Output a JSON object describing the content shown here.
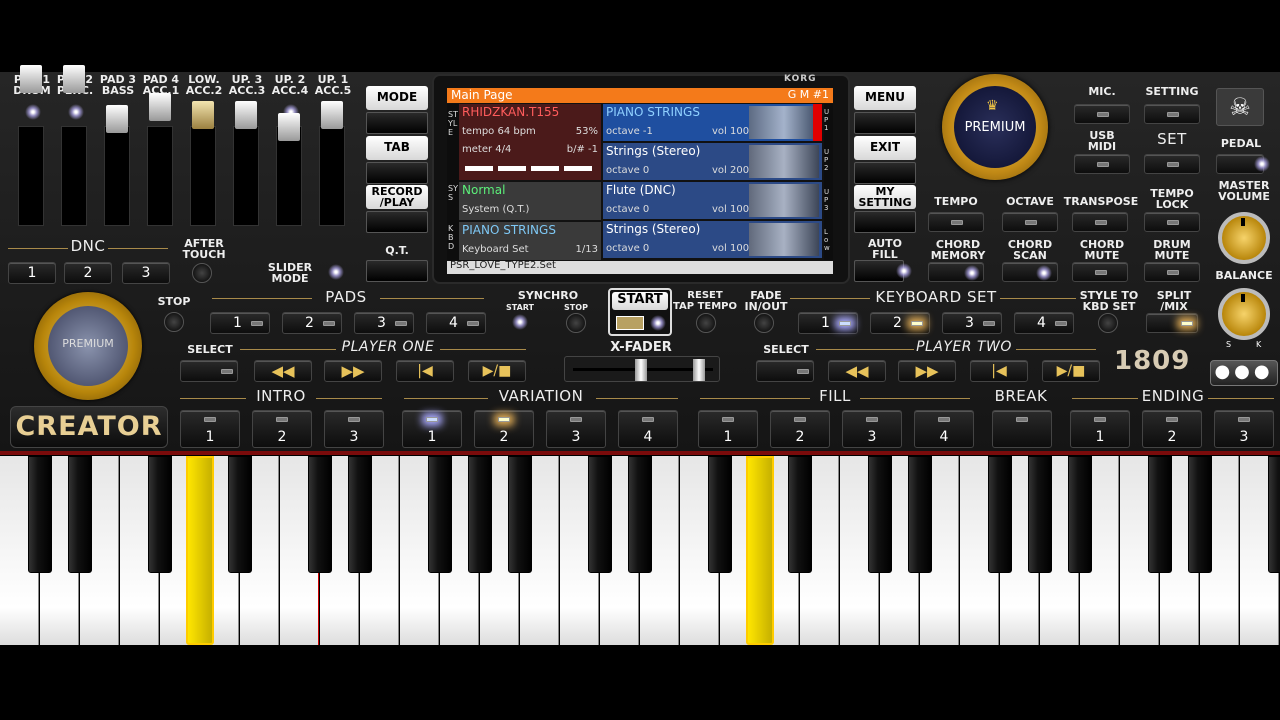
{
  "drum_channels": [
    "PAD 1\nDRUM",
    "PAD 2\nPERC.",
    "PAD 3\nBASS",
    "PAD 4\nACC.1",
    "LOW.\nACC.2",
    "UP. 3\nACC.3",
    "UP. 2\nACC.4",
    "UP. 1\nACC.5"
  ],
  "dnc": {
    "label": "DNC",
    "buttons": [
      "1",
      "2",
      "3"
    ],
    "after_touch": "AFTER\nTOUCH",
    "slider_mode": "SLIDER\nMODE"
  },
  "left_buttons": {
    "mode": "MODE",
    "tab": "TAB",
    "record": "RECORD\n/PLAY",
    "qt": "Q.T."
  },
  "right_buttons": {
    "menu": "MENU",
    "exit": "EXIT",
    "my_setting": "MY\nSETTING",
    "auto_fill": "AUTO\nFILL"
  },
  "screen": {
    "brand": "KORG",
    "title": "Main Page",
    "gm": "G M #1",
    "style_name": "RHIDZKAN.T155",
    "tempo": "tempo 64 bpm",
    "percent": "53%",
    "meter": "meter 4/4",
    "bsharp": "b/# -1",
    "sys_name": "Normal",
    "sys_sub": "System (Q.T.)",
    "kbd_name": "PIANO STRINGS",
    "kbd_sub": "Keyboard Set",
    "kbd_count": "1/13",
    "side_left": [
      "STYLE",
      "SYS",
      "KBD"
    ],
    "side_right": [
      "UP 1",
      "UP 2",
      "UP 3",
      "Low"
    ],
    "tracks": [
      {
        "name": "PIANO STRINGS",
        "octave": "octave -1",
        "vol": "vol 100"
      },
      {
        "name": "Strings (Stereo)",
        "octave": "octave  0",
        "vol": "vol 200"
      },
      {
        "name": "Flute (DNC)",
        "octave": "octave  0",
        "vol": "vol 100"
      },
      {
        "name": "Strings (Stereo)",
        "octave": "octave  0",
        "vol": "vol 100"
      }
    ],
    "footer": "PSR_LOVE_TYPE2.Set"
  },
  "premium": "PREMIUM",
  "creator": "CREATOR",
  "model": "1809",
  "top_right": {
    "mic": "MIC.",
    "setting": "SETTING",
    "usb": "USB\nMIDI",
    "set": "SET",
    "pedal": "PEDAL",
    "master_volume": "MASTER\nVOLUME",
    "balance": "BALANCE",
    "s": "S",
    "k": "K"
  },
  "row2": {
    "tempo": "TEMPO",
    "octave": "OCTAVE",
    "transpose": "TRANSPOSE",
    "tempo_lock": "TEMPO\nLOCK"
  },
  "row3": {
    "chord_memory": "CHORD\nMEMORY",
    "chord_scan": "CHORD\nSCAN",
    "chord_mute": "CHORD\nMUTE",
    "drum_mute": "DRUM\nMUTE"
  },
  "pads": {
    "stop": "STOP",
    "label": "PADS",
    "buttons": [
      "1",
      "2",
      "3",
      "4"
    ]
  },
  "transport": {
    "synchro": "SYNCHRO",
    "start_small": "START",
    "stop_small": "STOP",
    "start": "START",
    "reset": "RESET\nTAP TEMPO",
    "fade": "FADE\nIN/OUT",
    "xfader": "X-FADER"
  },
  "keyboard_set": {
    "label": "KEYBOARD SET",
    "buttons": [
      "1",
      "2",
      "3",
      "4"
    ],
    "style_to_kbd": "STYLE TO\nKBD SET",
    "split": "SPLIT\n/MIX"
  },
  "player_one": {
    "select": "SELECT",
    "label": "PLAYER ONE"
  },
  "player_two": {
    "select": "SELECT",
    "label": "PLAYER TWO"
  },
  "sections": {
    "intro": "INTRO",
    "variation": "VARIATION",
    "fill": "FILL",
    "break": "BREAK",
    "ending": "ENDING"
  },
  "section_buttons": [
    "1",
    "2",
    "3",
    "1",
    "2",
    "3",
    "4",
    "1",
    "2",
    "3",
    "4",
    "",
    "1",
    "2",
    "3"
  ]
}
